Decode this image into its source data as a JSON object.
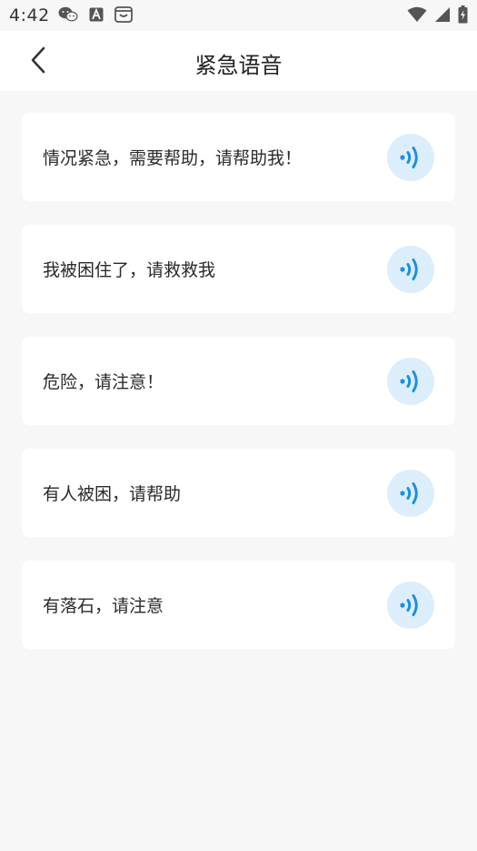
{
  "status_bar": {
    "time": "4:42"
  },
  "header": {
    "title": "紧急语音"
  },
  "voice_items": [
    {
      "text": "情况紧急，需要帮助，请帮助我！"
    },
    {
      "text": "我被困住了，请救救我"
    },
    {
      "text": "危险，请注意！"
    },
    {
      "text": "有人被困，请帮助"
    },
    {
      "text": "有落石，请注意"
    }
  ],
  "colors": {
    "accent": "#1e8fe0",
    "play_bg": "#dceefb",
    "page_bg": "#f7f7f7",
    "card_bg": "#ffffff"
  },
  "icons": {
    "back": "chevron-left-icon",
    "play": "sound-wave-icon"
  }
}
